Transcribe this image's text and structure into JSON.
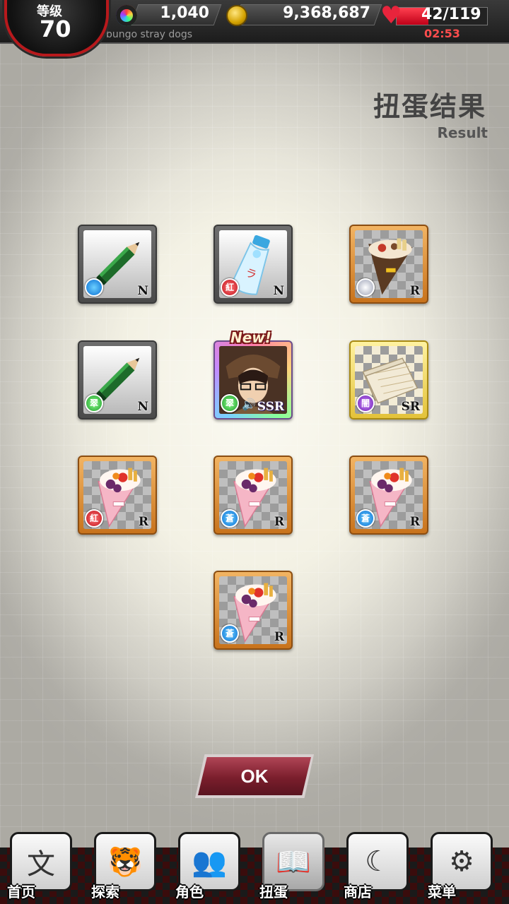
{
  "hud": {
    "level_label": "等级",
    "level": "70",
    "crystals": "1,040",
    "coins": "9,368,687",
    "stamina": "42/119",
    "stamina_fraction": 0.353,
    "timer": "02:53",
    "subtitle": "bungo stray dogs"
  },
  "header": {
    "title": "扭蛋结果",
    "subtitle": "Result"
  },
  "items": [
    {
      "name": "green-pencil",
      "rarity": "N",
      "attribute": "blue",
      "attr_label": ""
    },
    {
      "name": "ramune-bottle",
      "rarity": "N",
      "attribute": "red",
      "attr_label": "紅"
    },
    {
      "name": "chocolate-crepe",
      "rarity": "R",
      "attribute": "silver",
      "attr_label": ""
    },
    {
      "name": "green-pencil",
      "rarity": "N",
      "attribute": "green",
      "attr_label": "翠"
    },
    {
      "name": "character-card",
      "rarity": "SSR",
      "attribute": "green",
      "attr_label": "翠",
      "new_label": "New!"
    },
    {
      "name": "manuscript-paper",
      "rarity": "SR",
      "attribute": "purple",
      "attr_label": "闇"
    },
    {
      "name": "fruit-crepe",
      "rarity": "R",
      "attribute": "red",
      "attr_label": "紅"
    },
    {
      "name": "fruit-crepe",
      "rarity": "R",
      "attribute": "blue",
      "attr_label": "蒼"
    },
    {
      "name": "fruit-crepe",
      "rarity": "R",
      "attribute": "blue",
      "attr_label": "蒼"
    },
    {
      "name": "fruit-crepe",
      "rarity": "R",
      "attribute": "blue",
      "attr_label": "蒼"
    }
  ],
  "ok_button": "OK",
  "nav": [
    {
      "label": "首页",
      "icon": "bungo-logo-icon",
      "glyph": "文"
    },
    {
      "label": "探索",
      "icon": "tiger-icon",
      "glyph": "🐯"
    },
    {
      "label": "角色",
      "icon": "characters-icon",
      "glyph": "👥"
    },
    {
      "label": "扭蛋",
      "icon": "book-icon",
      "glyph": "📖"
    },
    {
      "label": "商店",
      "icon": "crescent-moon-icon",
      "glyph": "☾"
    },
    {
      "label": "菜单",
      "icon": "gear-icon",
      "glyph": "⚙"
    }
  ]
}
